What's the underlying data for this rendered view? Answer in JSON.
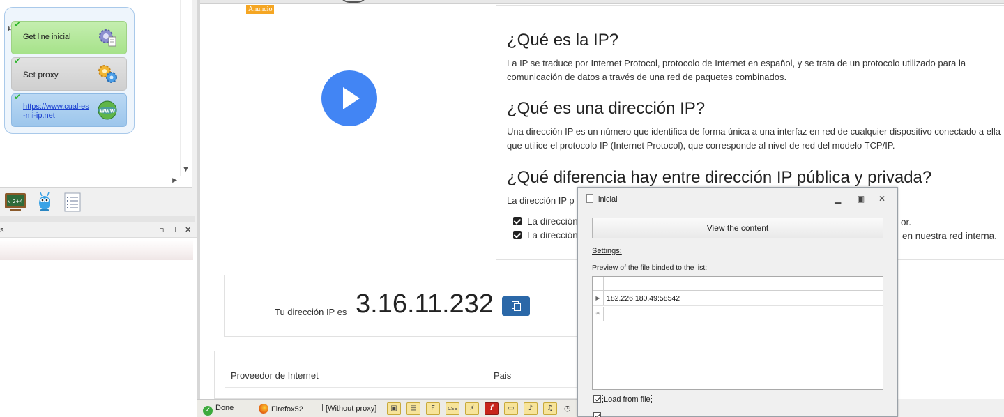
{
  "flow": {
    "nodes": [
      {
        "label": "Get line inicial",
        "icon": "gear-document-icon",
        "status": "ok"
      },
      {
        "label": "Set proxy",
        "icon": "gears-icon",
        "status": "ok"
      },
      {
        "label": "https://www.cual-es-mi-ip.net",
        "label_line1": "https://www.cual-es",
        "label_line2": "-mi-ip.net",
        "icon": "globe-www-icon",
        "status": "ok"
      }
    ]
  },
  "left_toolbar": {
    "icons": [
      "chalkboard-icon",
      "robot-icon",
      "list-document-icon"
    ],
    "chalkboard_text": "√ 2+4"
  },
  "left_panel": {
    "title": "s"
  },
  "browser": {
    "ad_badge": "Anuncio",
    "sections": [
      {
        "heading": "¿Qué es la IP?",
        "text": "La IP se traduce por Internet Protocol, protocolo de Internet en español, y se trata de un protocolo utilizado para la comunicación de datos a través de una red de paquetes combinados."
      },
      {
        "heading": "¿Qué es una dirección IP?",
        "text": "Una dirección IP es un número que identifica de forma única a una interfaz en red de cualquier dispositivo conectado a ella que utilice el protocolo IP (Internet Protocol), que corresponde al nivel de red del modelo TCP/IP."
      },
      {
        "heading": "¿Qué diferencia hay entre dirección IP pública y privada?",
        "text_visible": "La dirección IP p",
        "bullets": [
          {
            "visible_start": "La dirección",
            "visible_end": "or."
          },
          {
            "visible_start": "La dirección",
            "visible_end": "en nuestra red interna."
          }
        ]
      }
    ],
    "ip_label": "Tu dirección IP es",
    "ip_value": "3.16.11.232",
    "provider_col": "Proveedor de Internet",
    "country_col": "Pais"
  },
  "statusbar": {
    "done": "Done",
    "browser": "Firefox52",
    "proxy": "[Without proxy]",
    "tools": [
      "image-icon",
      "window-icon",
      "frame-icon",
      "css-icon",
      "flash-icon",
      "flash-player-icon",
      "monitor-icon",
      "bell-icon",
      "music-icon"
    ],
    "tool_glyphs": [
      "▣",
      "▤",
      "F",
      "CSS",
      "⚡",
      "f",
      "▭",
      "♪",
      "♫"
    ]
  },
  "dialog": {
    "title": "inicial",
    "view_button": "View the content",
    "settings_label": "Settings:",
    "preview_label": "Preview of the file binded to the list:",
    "rows": [
      "182.226.180.49:58542"
    ],
    "load_from_file": "Load from file",
    "load_checked": true,
    "second_checkbox_checked": true
  },
  "colors": {
    "play_button": "#4285f4",
    "ad_badge": "#f5a623",
    "copy_button": "#2b68a8",
    "node_green": "#b3e89a",
    "node_blue": "#a9cff0"
  }
}
